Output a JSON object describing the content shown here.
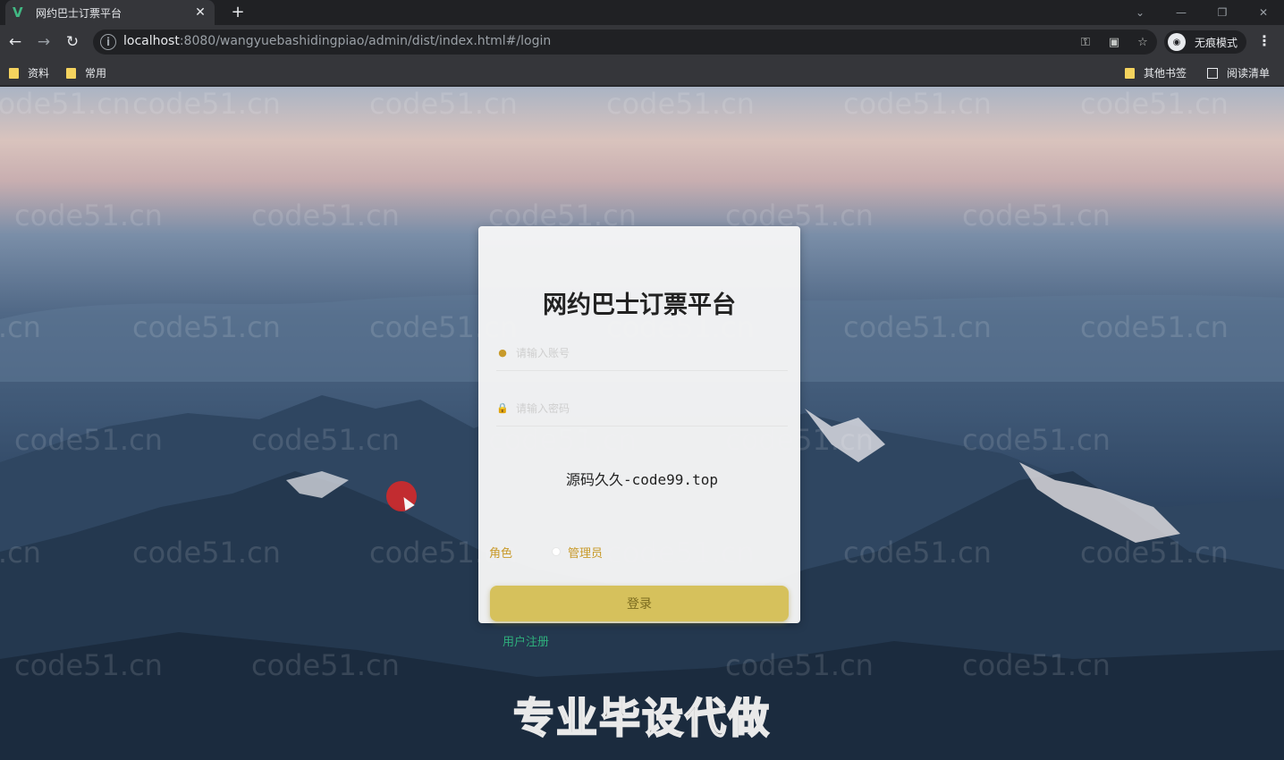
{
  "browser": {
    "tab_title": "网约巴士订票平台",
    "tab_favicon": "V",
    "url_host": "localhost",
    "url_rest": ":8080/wangyuebashidingpiao/admin/dist/index.html#/login",
    "incognito_label": "无痕模式",
    "bookmarks": {
      "left": [
        "资料",
        "常用"
      ],
      "other": "其他书签",
      "reading_list": "阅读清单"
    }
  },
  "watermark_text": "code51.cn",
  "login": {
    "title": "网约巴士订票平台",
    "username_placeholder": "请输入账号",
    "password_placeholder": "请输入密码",
    "overlay_text": "源码久久-code99.top",
    "role_label": "角色",
    "role_option": "管理员",
    "login_button": "登录",
    "register_link": "用户注册"
  },
  "bottom_banner": "专业毕设代做",
  "colors": {
    "accent_gold": "#d6c15c",
    "label_gold": "#c89a2a",
    "register_green": "#2eae7b"
  }
}
